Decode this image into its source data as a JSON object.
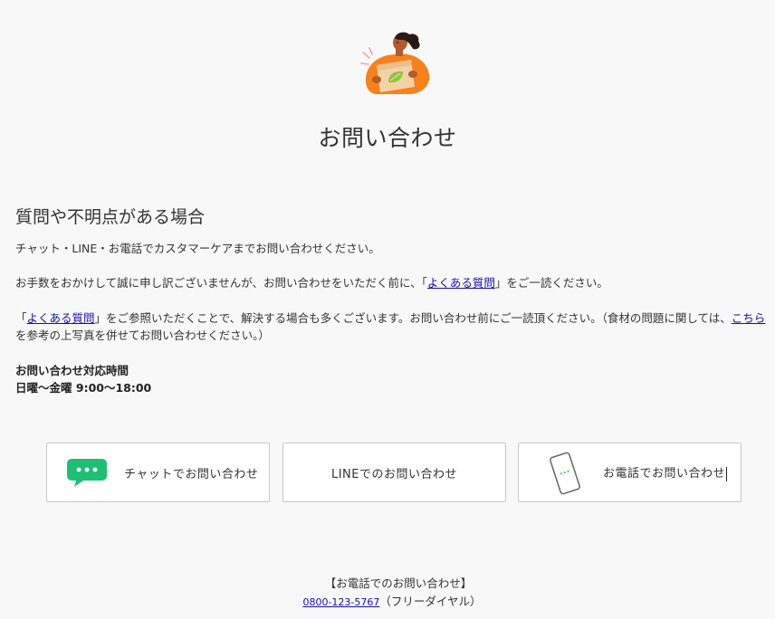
{
  "page": {
    "title": "お問い合わせ"
  },
  "section": {
    "heading": "質問や不明点がある場合",
    "p1": "チャット・LINE・お電話でカスタマーケアまでお問い合わせください。",
    "p2_before": "お手数をおかけして誠に申し訳ございませんが、お問い合わせをいただく前に、「",
    "p2_link": "よくある質問",
    "p2_after": "」をご一読ください。",
    "p3_open": "「",
    "p3_link": "よくある質問",
    "p3_mid": "」をご参照いただくことで、解決する場合も多くございます。お問い合わせ前にご一読頂ください。（食材の問題に関しては、",
    "p3_link2": "こちら",
    "p3_end": "を参考の上写真を併せてお問い合わせください。）"
  },
  "hours": {
    "label": "お問い合わせ対応時間",
    "days": "日曜〜金曜",
    "time": "9:00〜18:00"
  },
  "buttons": {
    "chat": "チャットでお問い合わせ",
    "line": "LINEでのお問い合わせ",
    "phone": "お電話でお問い合わせ"
  },
  "footer": {
    "title": "【お電話でのお問い合わせ】",
    "phone_number": "0800-123-5767",
    "phone_note": "（フリーダイヤル）"
  },
  "icons": {
    "hero": "person-holding-box-illustration",
    "chat": "chat-bubble-icon",
    "phone": "smartphone-icon"
  },
  "colors": {
    "accent_orange": "#f7821b",
    "chat_green": "#1dbf73",
    "link_blue": "#1a0dab",
    "background": "#f8f8f8"
  }
}
